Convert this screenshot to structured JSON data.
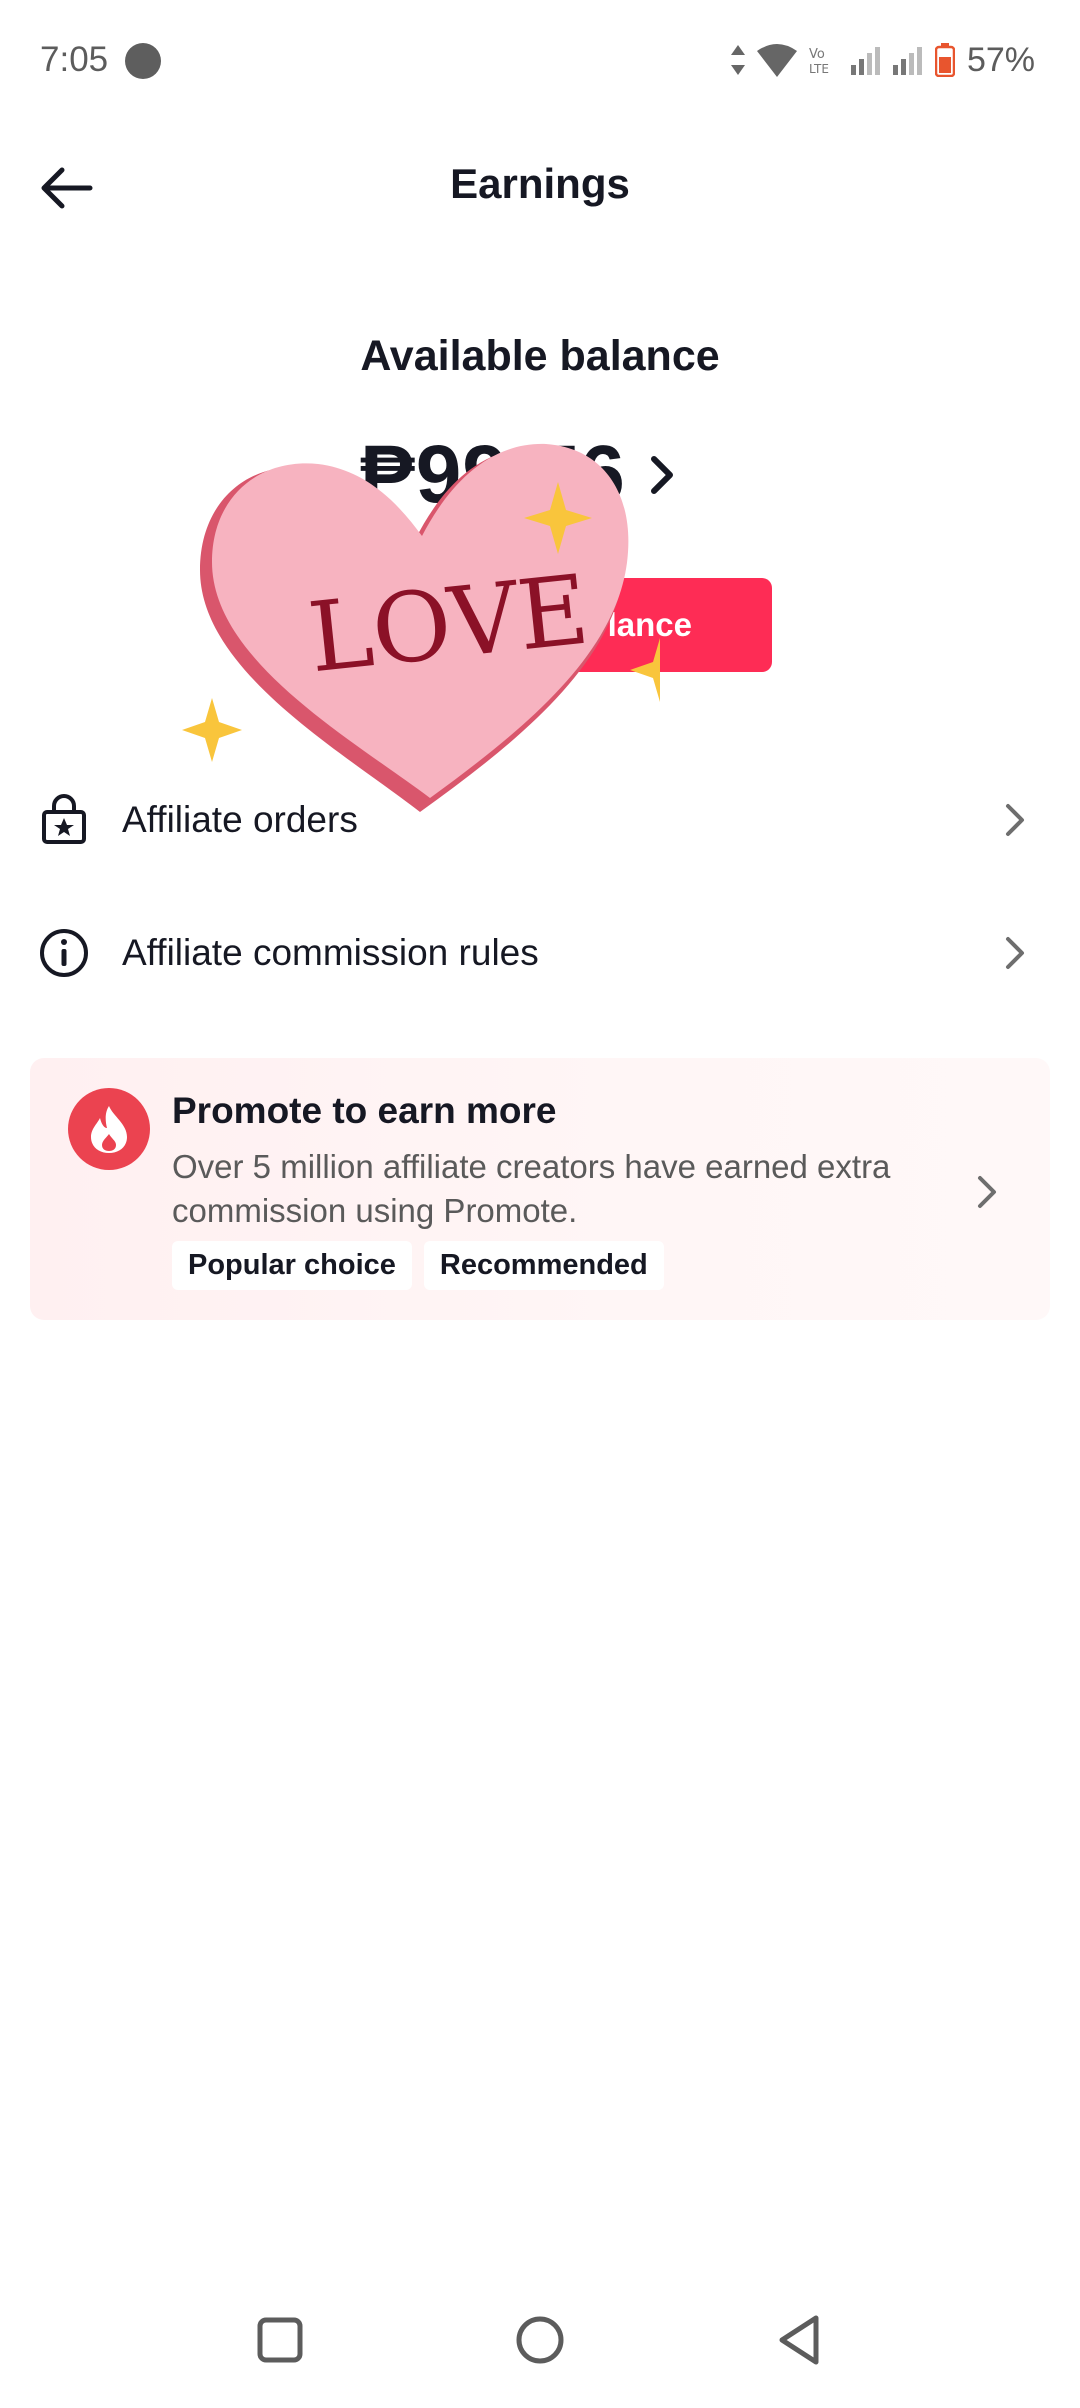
{
  "status_bar": {
    "time": "7:05",
    "battery": "57%",
    "network_label": "Vo LTE"
  },
  "header": {
    "title": "Earnings"
  },
  "balance": {
    "label": "Available balance",
    "amount": "₱99.76",
    "button_label": "Withdraw balance",
    "button_visible_text": "lance"
  },
  "sticker": {
    "text": "LOVE"
  },
  "menu": {
    "items": [
      {
        "label": "Affiliate orders",
        "icon": "shopping-bag-star-icon"
      },
      {
        "label": "Affiliate commission rules",
        "icon": "info-circle-icon"
      }
    ]
  },
  "promote": {
    "title": "Promote to earn more",
    "description": "Over 5 million affiliate creators have earned extra commission using Promote.",
    "tags": [
      "Popular choice",
      "Recommended"
    ],
    "icon": "fire-icon"
  },
  "colors": {
    "accent": "#fe2c55",
    "promote_icon_bg": "#eb4350",
    "promote_bg": "#fff0f1",
    "sticker_heart": "#f7b3c0",
    "sparkle": "#f9c53c"
  }
}
